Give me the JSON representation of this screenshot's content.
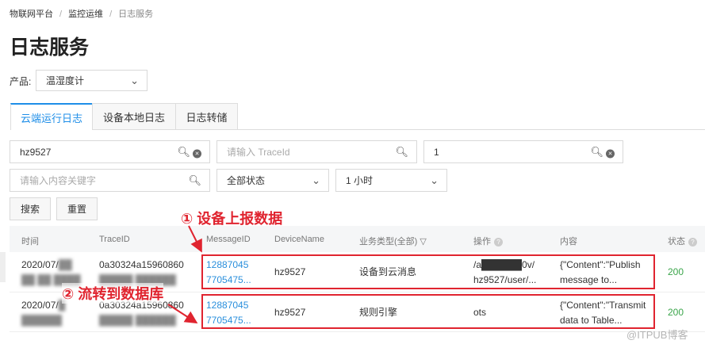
{
  "breadcrumb": [
    "物联网平台",
    "监控运维",
    "日志服务"
  ],
  "page_title": "日志服务",
  "product": {
    "label": "产品:",
    "value": "温湿度计"
  },
  "tabs": [
    "云端运行日志",
    "设备本地日志",
    "日志转储"
  ],
  "filters": {
    "device_value": "hz9527",
    "traceid_placeholder": "请输入 TraceId",
    "third_value": "1",
    "keyword_placeholder": "请输入内容关键字",
    "status_value": "全部状态",
    "time_value": "1 小时"
  },
  "buttons": {
    "search": "搜索",
    "reset": "重置"
  },
  "table": {
    "headers": [
      "时间",
      "TraceID",
      "MessageID",
      "DeviceName",
      "业务类型(全部)",
      "操作",
      "内容",
      "状态"
    ],
    "rows": [
      {
        "time1": "2020/07/",
        "time2": "██ ██ ████",
        "trace1": "0a30324a15960860",
        "trace2": "█████ ██████",
        "msg1": "12887045",
        "msg2": "7705475...",
        "device": "hz9527",
        "type": "设备到云消息",
        "op1": "/a██████0v/",
        "op2": "hz9527/user/...",
        "content1": "{\"Content\":\"Publish",
        "content2": "message to...",
        "status": "200"
      },
      {
        "time1": "2020/07/",
        "time2": "██████",
        "trace1": "0a30324a15960860",
        "trace2": "█████ ██████",
        "msg1": "12887045",
        "msg2": "7705475...",
        "device": "hz9527",
        "type": "规则引擎",
        "op1": "ots",
        "op2": "",
        "content1": "{\"Content\":\"Transmit",
        "content2": "data to Table...",
        "status": "200"
      }
    ]
  },
  "annotations": [
    "① 设备上报数据",
    "② 流转到数据库"
  ],
  "watermark": "@ITPUB博客",
  "colors": {
    "accent": "#1e8ee8",
    "annotation": "#e0242f",
    "success": "#3aa54a"
  }
}
